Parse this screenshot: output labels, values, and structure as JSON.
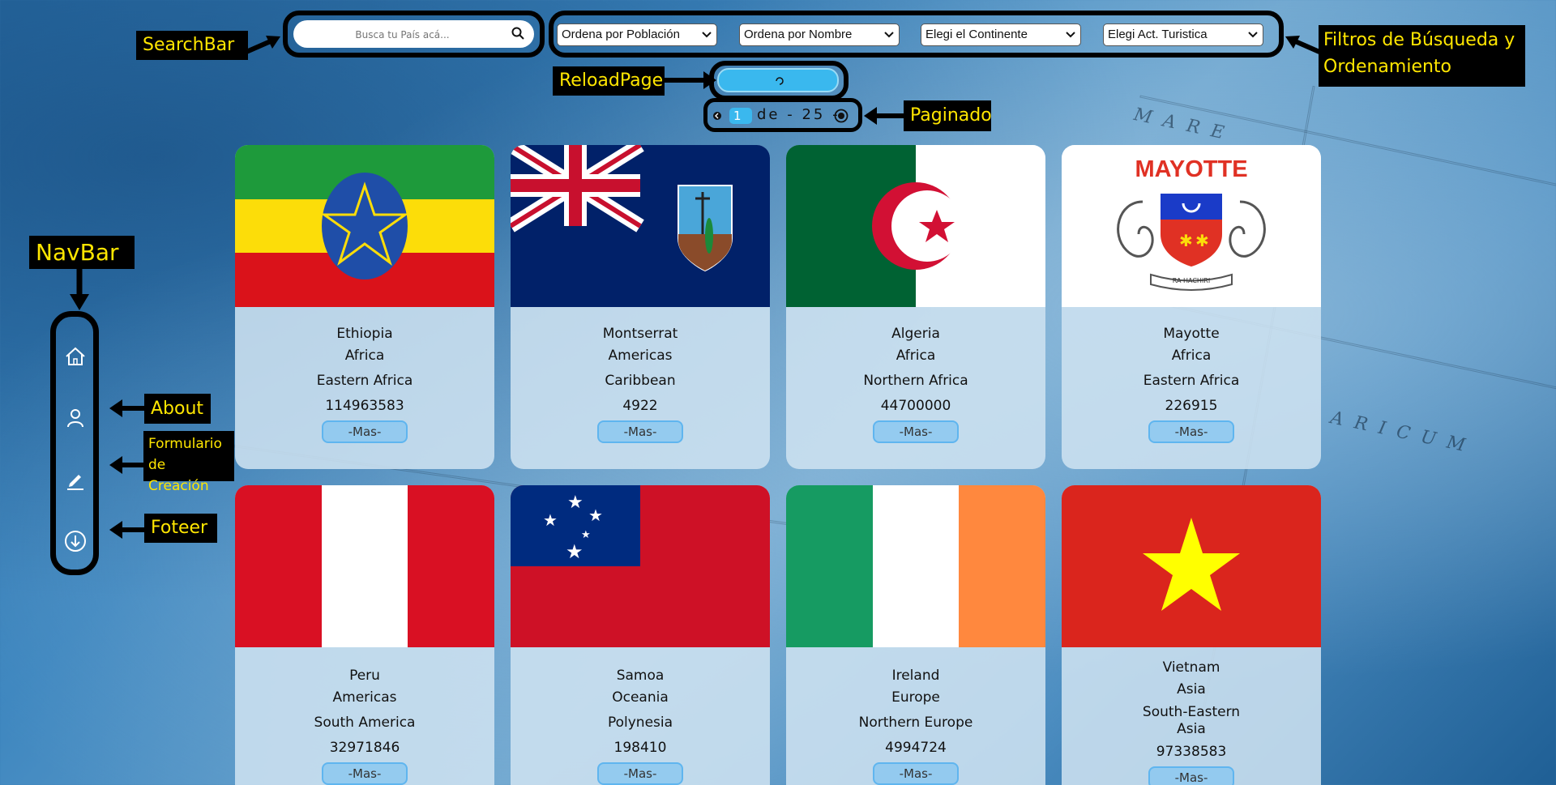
{
  "annotations": {
    "searchbar": "SearchBar",
    "filters": "Filtros de Búsqueda y Ordenamiento",
    "reload": "ReloadPage",
    "paginado": "Paginado",
    "navbar": "NavBar",
    "about": "About",
    "formulario_line1": "Formulario",
    "formulario_line2": "de Creación",
    "footer": "Foteer"
  },
  "search": {
    "placeholder": "Busca tu País acá..."
  },
  "filters": {
    "population": "Ordena por Población",
    "name": "Ordena por Nombre",
    "continent": "Elegi el Continente",
    "activity": "Elegi Act. Turistica"
  },
  "pagination": {
    "current": "1",
    "label": "de - 25 -"
  },
  "cards": [
    {
      "name": "Ethiopia",
      "continent": "Africa",
      "subregion": "Eastern Africa",
      "population": "114963583",
      "button": "-Mas-"
    },
    {
      "name": "Montserrat",
      "continent": "Americas",
      "subregion": "Caribbean",
      "population": "4922",
      "button": "-Mas-"
    },
    {
      "name": "Algeria",
      "continent": "Africa",
      "subregion": "Northern Africa",
      "population": "44700000",
      "button": "-Mas-"
    },
    {
      "name": "Mayotte",
      "continent": "Africa",
      "subregion": "Eastern Africa",
      "population": "226915",
      "button": "-Mas-",
      "flag_text": "MAYOTTE",
      "flag_motto": "RA HACHIRI"
    },
    {
      "name": "Peru",
      "continent": "Americas",
      "subregion": "South America",
      "population": "32971846",
      "button": "-Mas-"
    },
    {
      "name": "Samoa",
      "continent": "Oceania",
      "subregion": "Polynesia",
      "population": "198410",
      "button": "-Mas-"
    },
    {
      "name": "Ireland",
      "continent": "Europe",
      "subregion": "Northern Europe",
      "population": "4994724",
      "button": "-Mas-"
    },
    {
      "name": "Vietnam",
      "continent": "Asia",
      "subregion_line1": "South-Eastern",
      "subregion_line2": "Asia",
      "population": "97338583",
      "button": "-Mas-"
    }
  ],
  "background_words": [
    "MARE",
    "ARICUM"
  ],
  "colors": {
    "accent": "#3ab8ee",
    "annotation_text": "#ffe600"
  }
}
